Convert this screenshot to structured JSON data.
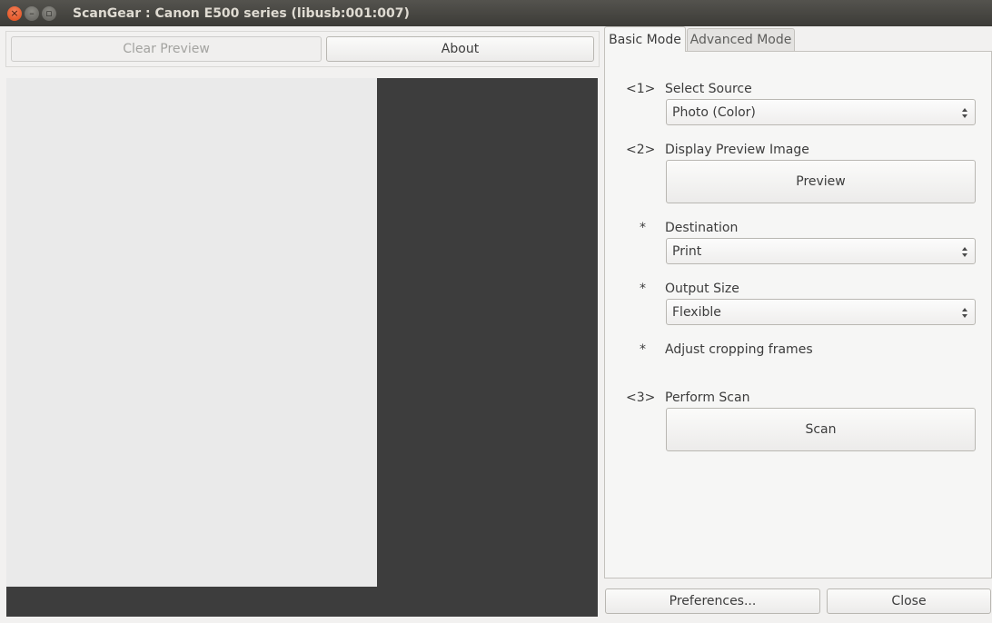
{
  "window": {
    "title": "ScanGear : Canon E500 series (libusb:001:007)",
    "controls": {
      "close_glyph": "×",
      "minimize_glyph": "–",
      "maximize_glyph": "▫"
    }
  },
  "toolbar": {
    "clear_preview_label": "Clear Preview",
    "about_label": "About"
  },
  "tabs": {
    "basic_label": "Basic Mode",
    "advanced_label": "Advanced Mode"
  },
  "basic_mode": {
    "step1": {
      "num": "<1>",
      "label": "Select Source",
      "value": "Photo (Color)"
    },
    "step2": {
      "num": "<2>",
      "label": "Display Preview Image",
      "button_label": "Preview"
    },
    "destination": {
      "num": "*",
      "label": "Destination",
      "value": "Print"
    },
    "output_size": {
      "num": "*",
      "label": "Output Size",
      "value": "Flexible"
    },
    "cropping": {
      "num": "*",
      "label": "Adjust cropping frames"
    },
    "step3": {
      "num": "<3>",
      "label": "Perform Scan",
      "button_label": "Scan"
    }
  },
  "footer": {
    "preferences_label": "Preferences...",
    "close_label": "Close"
  },
  "colors": {
    "titlebar": "#3c3b37",
    "close_button": "#df4a16",
    "preview_background": "#3d3d3d",
    "preview_paper": "#eaeaea",
    "window_background": "#f2f1f0"
  }
}
